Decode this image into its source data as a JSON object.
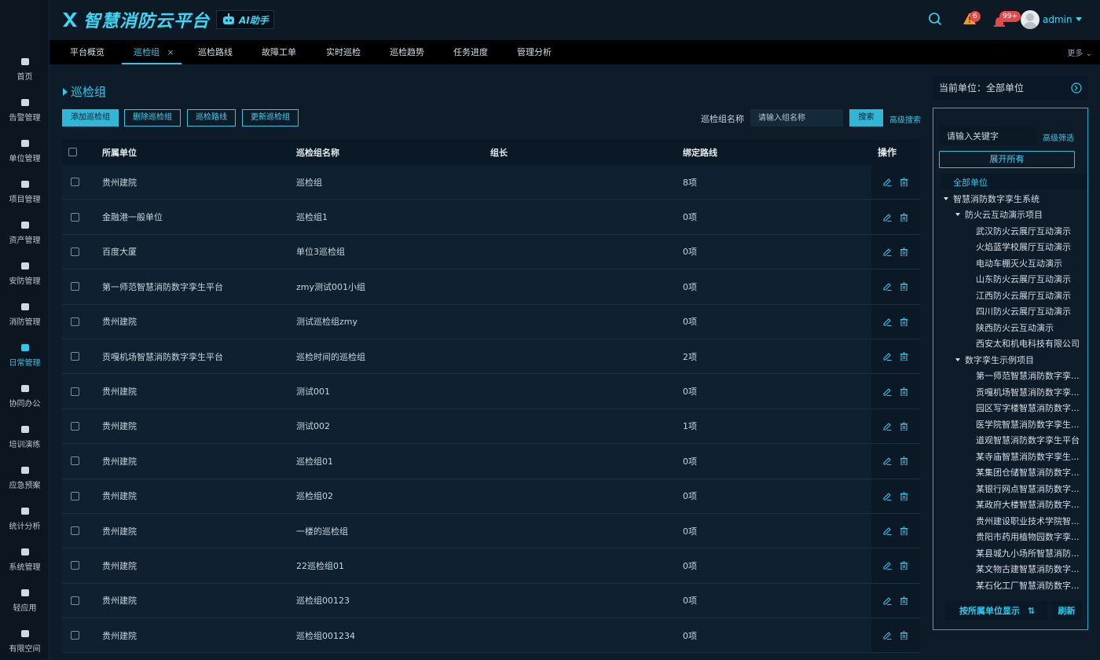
{
  "app": {
    "title": "智慧消防云平台",
    "ai_label": "AI助手"
  },
  "header": {
    "alert_count": "6",
    "notify_count": "99+",
    "user": "admin"
  },
  "sidebar": [
    {
      "label": "首页",
      "icon": "home-icon"
    },
    {
      "label": "告警管理",
      "icon": "alarm-icon"
    },
    {
      "label": "单位管理",
      "icon": "unit-icon"
    },
    {
      "label": "项目管理",
      "icon": "project-icon"
    },
    {
      "label": "资产管理",
      "icon": "asset-icon"
    },
    {
      "label": "安防管理",
      "icon": "security-icon"
    },
    {
      "label": "消防管理",
      "icon": "fire-icon"
    },
    {
      "label": "日常管理",
      "icon": "calendar-icon",
      "active": true
    },
    {
      "label": "协同办公",
      "icon": "office-icon"
    },
    {
      "label": "培训演练",
      "icon": "training-icon"
    },
    {
      "label": "应急预案",
      "icon": "emergency-icon"
    },
    {
      "label": "统计分析",
      "icon": "stats-icon"
    },
    {
      "label": "系统管理",
      "icon": "system-icon"
    },
    {
      "label": "轻应用",
      "icon": "apps-icon"
    },
    {
      "label": "有限空间",
      "icon": "space-icon"
    }
  ],
  "tabs": [
    "平台概览",
    "巡检组",
    "巡检路线",
    "故障工单",
    "实时巡检",
    "巡检趋势",
    "任务进度",
    "管理分析"
  ],
  "tabs_more": "更多",
  "page": {
    "title": "巡检组",
    "buttons": {
      "add": "添加巡检组",
      "delete": "删除巡检组",
      "route": "巡检路线",
      "update": "更新巡检组"
    },
    "search_label": "巡检组名称",
    "search_placeholder": "请输入组名称",
    "search_btn": "搜索",
    "advanced": "高级搜索"
  },
  "table": {
    "headers": {
      "unit": "所属单位",
      "name": "巡检组名称",
      "leader": "组长",
      "routes": "绑定路线",
      "ops": "操作"
    },
    "rows": [
      {
        "unit": "贵州建院",
        "name": "巡检组",
        "leader": "",
        "routes": "8项"
      },
      {
        "unit": "金融港一般单位",
        "name": "巡检组1",
        "leader": "",
        "routes": "0项"
      },
      {
        "unit": "百度大厦",
        "name": "单位3巡检组",
        "leader": "",
        "routes": "0项"
      },
      {
        "unit": "第一师范智慧消防数字孪生平台",
        "name": "zmy测试001小组",
        "leader": "",
        "routes": "0项"
      },
      {
        "unit": "贵州建院",
        "name": "测试巡检组zmy",
        "leader": "",
        "routes": "0项"
      },
      {
        "unit": "贡嘎机场智慧消防数字孪生平台",
        "name": "巡检时间的巡检组",
        "leader": "",
        "routes": "2项"
      },
      {
        "unit": "贵州建院",
        "name": "测试001",
        "leader": "",
        "routes": "0项"
      },
      {
        "unit": "贵州建院",
        "name": "测试002",
        "leader": "",
        "routes": "1项"
      },
      {
        "unit": "贵州建院",
        "name": "巡检组01",
        "leader": "",
        "routes": "0项"
      },
      {
        "unit": "贵州建院",
        "name": "巡检组02",
        "leader": "",
        "routes": "0项"
      },
      {
        "unit": "贵州建院",
        "name": "一楼的巡检组",
        "leader": "",
        "routes": "0项"
      },
      {
        "unit": "贵州建院",
        "name": "22巡检组01",
        "leader": "",
        "routes": "0项"
      },
      {
        "unit": "贵州建院",
        "name": "巡检组00123",
        "leader": "",
        "routes": "0项"
      },
      {
        "unit": "贵州建院",
        "name": "巡检组001234",
        "leader": "",
        "routes": "0项"
      }
    ]
  },
  "right": {
    "current_unit": "当前单位：全部单位",
    "keyword_placeholder": "请输入关键字",
    "filter": "高级筛选",
    "expand_all": "展开所有",
    "tree": [
      {
        "label": "全部单位",
        "level": 0,
        "caret": false
      },
      {
        "label": "智慧消防数字孪生系统",
        "level": 1,
        "caret": true
      },
      {
        "label": "防火云互动演示项目",
        "level": 2,
        "caret": true
      },
      {
        "label": "武汉防火云展厅互动演示",
        "level": 3,
        "caret": false
      },
      {
        "label": "火焰蓝学校展厅互动演示",
        "level": 3,
        "caret": false
      },
      {
        "label": "电动车棚灭火互动演示",
        "level": 3,
        "caret": false
      },
      {
        "label": "山东防火云展厅互动演示",
        "level": 3,
        "caret": false
      },
      {
        "label": "江西防火云展厅互动演示",
        "level": 3,
        "caret": false
      },
      {
        "label": "四川防火云展厅互动演示",
        "level": 3,
        "caret": false
      },
      {
        "label": "陕西防火云互动演示",
        "level": 3,
        "caret": false
      },
      {
        "label": "西安太和机电科技有限公司",
        "level": 3,
        "caret": false
      },
      {
        "label": "数字孪生示例项目",
        "level": 2,
        "caret": true
      },
      {
        "label": "第一师范智慧消防数字孪...",
        "level": 3,
        "caret": false
      },
      {
        "label": "贡嘎机场智慧消防数字孪...",
        "level": 3,
        "caret": false
      },
      {
        "label": "园区写字楼智慧消防数字...",
        "level": 3,
        "caret": false
      },
      {
        "label": "医学院智慧消防数字孪生...",
        "level": 3,
        "caret": false
      },
      {
        "label": "道观智慧消防数字孪生平台",
        "level": 3,
        "caret": false
      },
      {
        "label": "某寺庙智慧消防数字孪生...",
        "level": 3,
        "caret": false
      },
      {
        "label": "某集团仓储智慧消防数字...",
        "level": 3,
        "caret": false
      },
      {
        "label": "某银行网点智慧消防数字...",
        "level": 3,
        "caret": false
      },
      {
        "label": "某政府大楼智慧消防数字...",
        "level": 3,
        "caret": false
      },
      {
        "label": "贵州建设职业技术学院智...",
        "level": 3,
        "caret": false
      },
      {
        "label": "贵阳市药用植物园数字孪...",
        "level": 3,
        "caret": false
      },
      {
        "label": "某县城九小场所智慧消防...",
        "level": 3,
        "caret": false
      },
      {
        "label": "某文物古建智慧消防数字...",
        "level": 3,
        "caret": false
      },
      {
        "label": "某石化工厂智慧消防数字...",
        "level": 3,
        "caret": false
      }
    ],
    "sort_label": "按所属单位显示",
    "refresh": "刷新"
  },
  "colors": {
    "accent": "#31c6ea",
    "background": "#0e1c2a",
    "badge": "#e24a4a"
  }
}
